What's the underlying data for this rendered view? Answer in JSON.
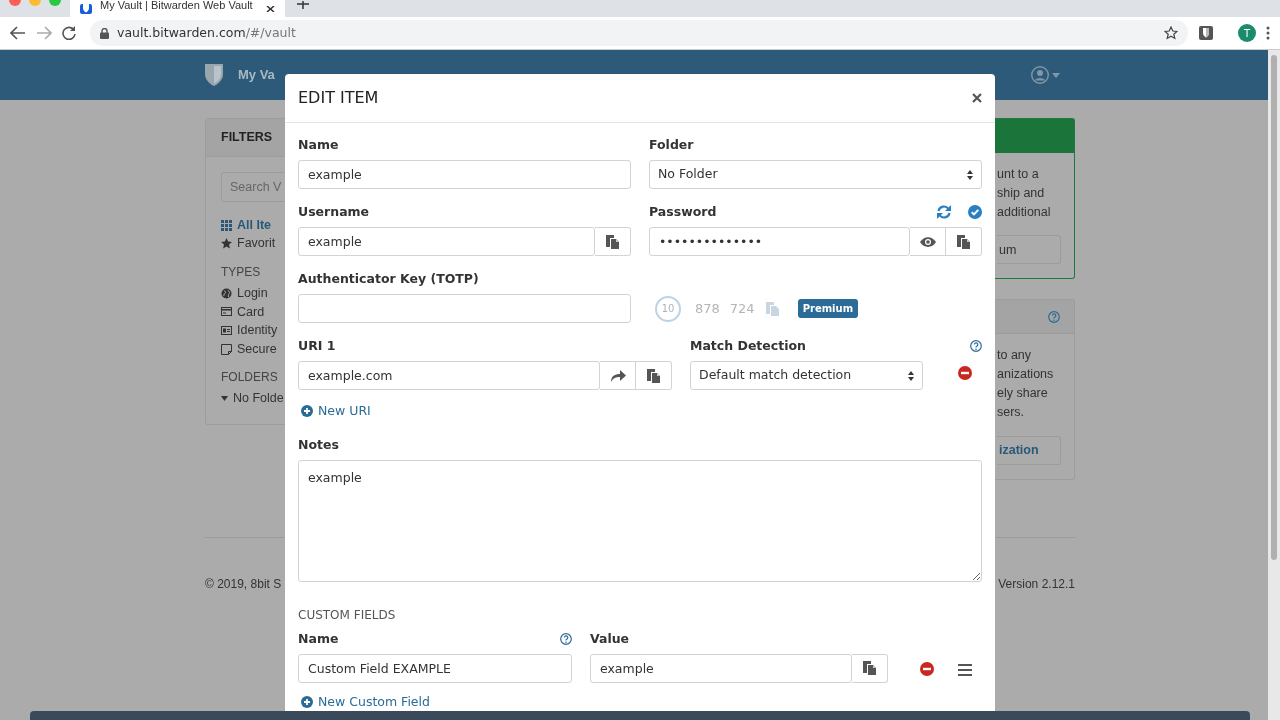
{
  "browser": {
    "tab_title": "My Vault | Bitwarden Web Vault",
    "url_host": "vault.bitwarden.com",
    "url_path": "/#/vault",
    "profile_initial": "T"
  },
  "navbar": {
    "items": [
      "My Va"
    ]
  },
  "filters": {
    "title": "FILTERS",
    "search_placeholder": "Search V",
    "items": [
      {
        "kind": "all",
        "label": "All Ite",
        "selected": true
      },
      {
        "kind": "favorites",
        "label": "Favorit",
        "selected": false
      }
    ],
    "types_heading": "TYPES",
    "types": [
      {
        "kind": "login",
        "label": "Login"
      },
      {
        "kind": "card",
        "label": "Card"
      },
      {
        "kind": "identity",
        "label": "Identity"
      },
      {
        "kind": "note",
        "label": "Secure"
      }
    ],
    "folders_heading": "FOLDERS",
    "folders": [
      {
        "label": "No Folde",
        "expanded": true
      }
    ]
  },
  "side_cards": [
    {
      "kind": "premium",
      "lines": [
        "unt to a",
        "ship and",
        "additional"
      ],
      "button": "um"
    },
    {
      "kind": "organization",
      "lines": [
        "to any",
        "anizations",
        "ely share",
        "sers."
      ],
      "button": "ization"
    }
  ],
  "footer": {
    "copyright": "© 2019, 8bit S",
    "version": "Version 2.12.1"
  },
  "modal": {
    "title": "EDIT ITEM",
    "name": {
      "label": "Name",
      "value": "example"
    },
    "folder": {
      "label": "Folder",
      "value": "No Folder"
    },
    "username": {
      "label": "Username",
      "value": "example"
    },
    "password": {
      "label": "Password",
      "value": "••••••••••••••"
    },
    "totp": {
      "label": "Authenticator Key (TOTP)",
      "countdown": "10",
      "code_1": "878",
      "code_2": "724",
      "badge": "Premium"
    },
    "uris": [
      {
        "label": "URI 1",
        "value": "example.com",
        "match_label": "Match Detection",
        "match_value": "Default match detection"
      }
    ],
    "new_uri": "New URI",
    "notes": {
      "label": "Notes",
      "value": "example"
    },
    "custom_fields_heading": "CUSTOM FIELDS",
    "custom_fields": [
      {
        "name_label": "Name",
        "value_label": "Value",
        "name": "Custom Field EXAMPLE",
        "value": "example"
      }
    ],
    "new_custom_field": "New Custom Field"
  }
}
